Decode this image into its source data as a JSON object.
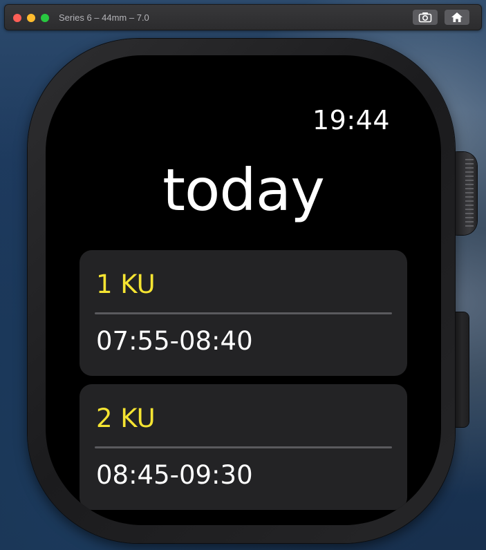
{
  "window": {
    "title": "Series 6 – 44mm – 7.0",
    "buttons": {
      "screenshot": "camera-icon",
      "home": "home-icon"
    },
    "traffic_colors": {
      "close": "#fe5f57",
      "minimize": "#febc2e",
      "zoom": "#28c840"
    }
  },
  "watch": {
    "clock": "19:44",
    "title": "today",
    "accent_color": "#f5e432",
    "lessons": [
      {
        "label": "1 KU",
        "time": "07:55-08:40"
      },
      {
        "label": "2 KU",
        "time": "08:45-09:30"
      }
    ]
  }
}
